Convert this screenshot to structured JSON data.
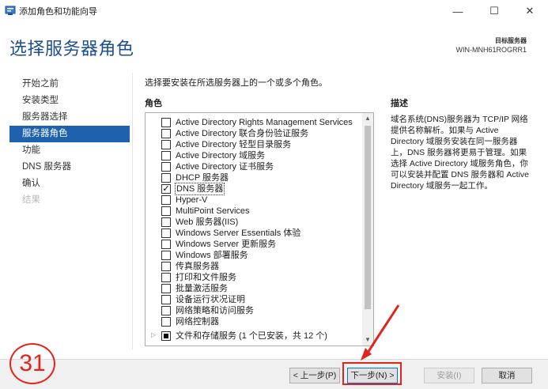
{
  "window": {
    "title": "添加角色和功能向导",
    "minimize_glyph": "—",
    "maximize_glyph": "☐",
    "close_glyph": "✕"
  },
  "header": {
    "title": "选择服务器角色",
    "target_label": "目标服务器",
    "target_server": "WIN-MNH61ROGRR1"
  },
  "nav": {
    "items": [
      {
        "label": "开始之前",
        "state": "normal"
      },
      {
        "label": "安装类型",
        "state": "normal"
      },
      {
        "label": "服务器选择",
        "state": "normal"
      },
      {
        "label": "服务器角色",
        "state": "active"
      },
      {
        "label": "功能",
        "state": "normal"
      },
      {
        "label": "DNS 服务器",
        "state": "normal"
      },
      {
        "label": "确认",
        "state": "normal"
      },
      {
        "label": "结果",
        "state": "disabled"
      }
    ]
  },
  "main": {
    "instruction": "选择要安装在所选服务器上的一个或多个角色。",
    "roles_heading": "角色",
    "roles": [
      {
        "label": "Active Directory Rights Management Services",
        "checked": ""
      },
      {
        "label": "Active Directory 联合身份验证服务",
        "checked": ""
      },
      {
        "label": "Active Directory 轻型目录服务",
        "checked": ""
      },
      {
        "label": "Active Directory 域服务",
        "checked": ""
      },
      {
        "label": "Active Directory 证书服务",
        "checked": ""
      },
      {
        "label": "DHCP 服务器",
        "checked": ""
      },
      {
        "label": "DNS 服务器",
        "checked": "✓"
      },
      {
        "label": "Hyper-V",
        "checked": ""
      },
      {
        "label": "MultiPoint Services",
        "checked": ""
      },
      {
        "label": "Web 服务器(IIS)",
        "checked": ""
      },
      {
        "label": "Windows Server Essentials 体验",
        "checked": ""
      },
      {
        "label": "Windows Server 更新服务",
        "checked": ""
      },
      {
        "label": "Windows 部署服务",
        "checked": ""
      },
      {
        "label": "传真服务器",
        "checked": ""
      },
      {
        "label": "打印和文件服务",
        "checked": ""
      },
      {
        "label": "批量激活服务",
        "checked": ""
      },
      {
        "label": "设备运行状况证明",
        "checked": ""
      },
      {
        "label": "网络策略和访问服务",
        "checked": ""
      },
      {
        "label": "网络控制器",
        "checked": ""
      },
      {
        "label": "文件和存储服务 (1 个已安装，共 12 个)",
        "checked": "",
        "expander": "▷"
      }
    ],
    "description_heading": "描述",
    "description_text": "域名系统(DNS)服务器为 TCP/IP 网络提供名称解析。如果与 Active Directory 域服务安装在同一服务器上，DNS 服务器将更易于管理。如果选择 Active Directory 域服务角色，你可以安装并配置 DNS 服务器和 Active Directory 域服务一起工作。"
  },
  "footer": {
    "prev_label": "< 上一步(P)",
    "next_label": "下一步(N) >",
    "install_label": "安装(I)",
    "cancel_label": "取消"
  },
  "annotation": {
    "step_number": "31",
    "color": "#e2241b"
  },
  "colors": {
    "accent": "#1e61ae",
    "title": "#1d4f91"
  }
}
